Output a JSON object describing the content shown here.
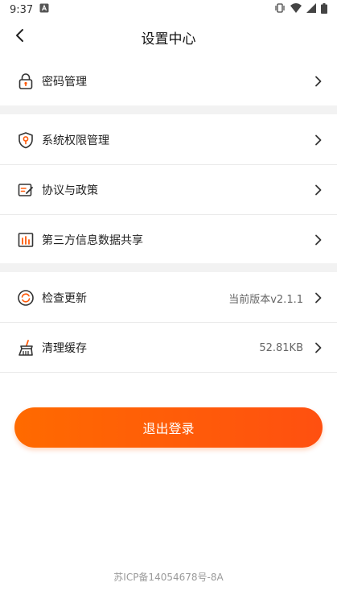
{
  "status_bar": {
    "time": "9:37"
  },
  "nav": {
    "title": "设置中心"
  },
  "groups": [
    {
      "items": [
        {
          "label": "密码管理",
          "icon": "lock-icon"
        }
      ]
    },
    {
      "items": [
        {
          "label": "系统权限管理",
          "icon": "shield-location-icon"
        },
        {
          "label": "协议与政策",
          "icon": "document-edit-icon"
        },
        {
          "label": "第三方信息数据共享",
          "icon": "bar-chart-icon"
        }
      ]
    },
    {
      "items": [
        {
          "label": "检查更新",
          "value": "当前版本v2.1.1",
          "icon": "refresh-icon"
        },
        {
          "label": "清理缓存",
          "value": "52.81KB",
          "icon": "broom-icon"
        }
      ]
    }
  ],
  "logout": {
    "label": "退出登录"
  },
  "footer": {
    "icp": "苏ICP备14054678号-8A"
  },
  "colors": {
    "accent": "#ff5a0a",
    "icon_stroke": "#333333",
    "icon_accent": "#ff5a0a"
  }
}
